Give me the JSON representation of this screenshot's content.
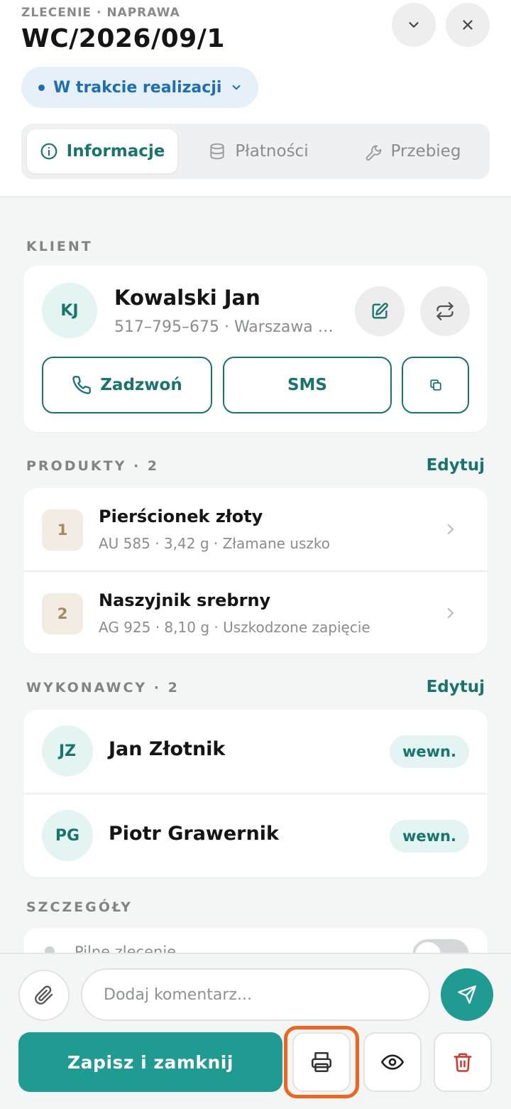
{
  "header": {
    "eyebrow": "ZLECENIE · NAPRAWA",
    "order_number": "WC/2026/09/1",
    "status": "W trakcie realizacji"
  },
  "tabs": [
    {
      "label": "Informacje",
      "icon": "info-icon",
      "active": true
    },
    {
      "label": "Płatności",
      "icon": "database-icon",
      "active": false
    },
    {
      "label": "Przebieg",
      "icon": "wrench-icon",
      "active": false
    }
  ],
  "client": {
    "section_label": "KLIENT",
    "initials": "KJ",
    "name": "Kowalski Jan",
    "subtitle": "517–795–675 · Warszawa C...",
    "call_label": "Zadzwoń",
    "sms_label": "SMS"
  },
  "products": {
    "section_label": "PRODUKTY · 2",
    "edit_label": "Edytuj",
    "items": [
      {
        "index": "1",
        "name": "Pierścionek złoty",
        "details": "AU 585 · 3,42 g · Złamane uszko"
      },
      {
        "index": "2",
        "name": "Naszyjnik srebrny",
        "details": "AG 925 · 8,10 g · Uszkodzone zapięcie"
      }
    ]
  },
  "performers": {
    "section_label": "WYKONAWCY · 2",
    "edit_label": "Edytuj",
    "items": [
      {
        "initials": "JZ",
        "name": "Jan Złotnik",
        "tag": "wewn."
      },
      {
        "initials": "PG",
        "name": "Piotr Grawernik",
        "tag": "wewn."
      }
    ]
  },
  "details": {
    "section_label": "SZCZEGÓŁY",
    "partial_row_label": "Pilne zlecenie"
  },
  "footer": {
    "comment_placeholder": "Dodaj komentarz...",
    "save_label": "Zapisz i zamknij"
  },
  "colors": {
    "accent": "#17756c",
    "primary_button": "#1f9b91",
    "status_blue": "#1d6eb5",
    "danger": "#d9342b",
    "highlight": "#f0641e"
  }
}
